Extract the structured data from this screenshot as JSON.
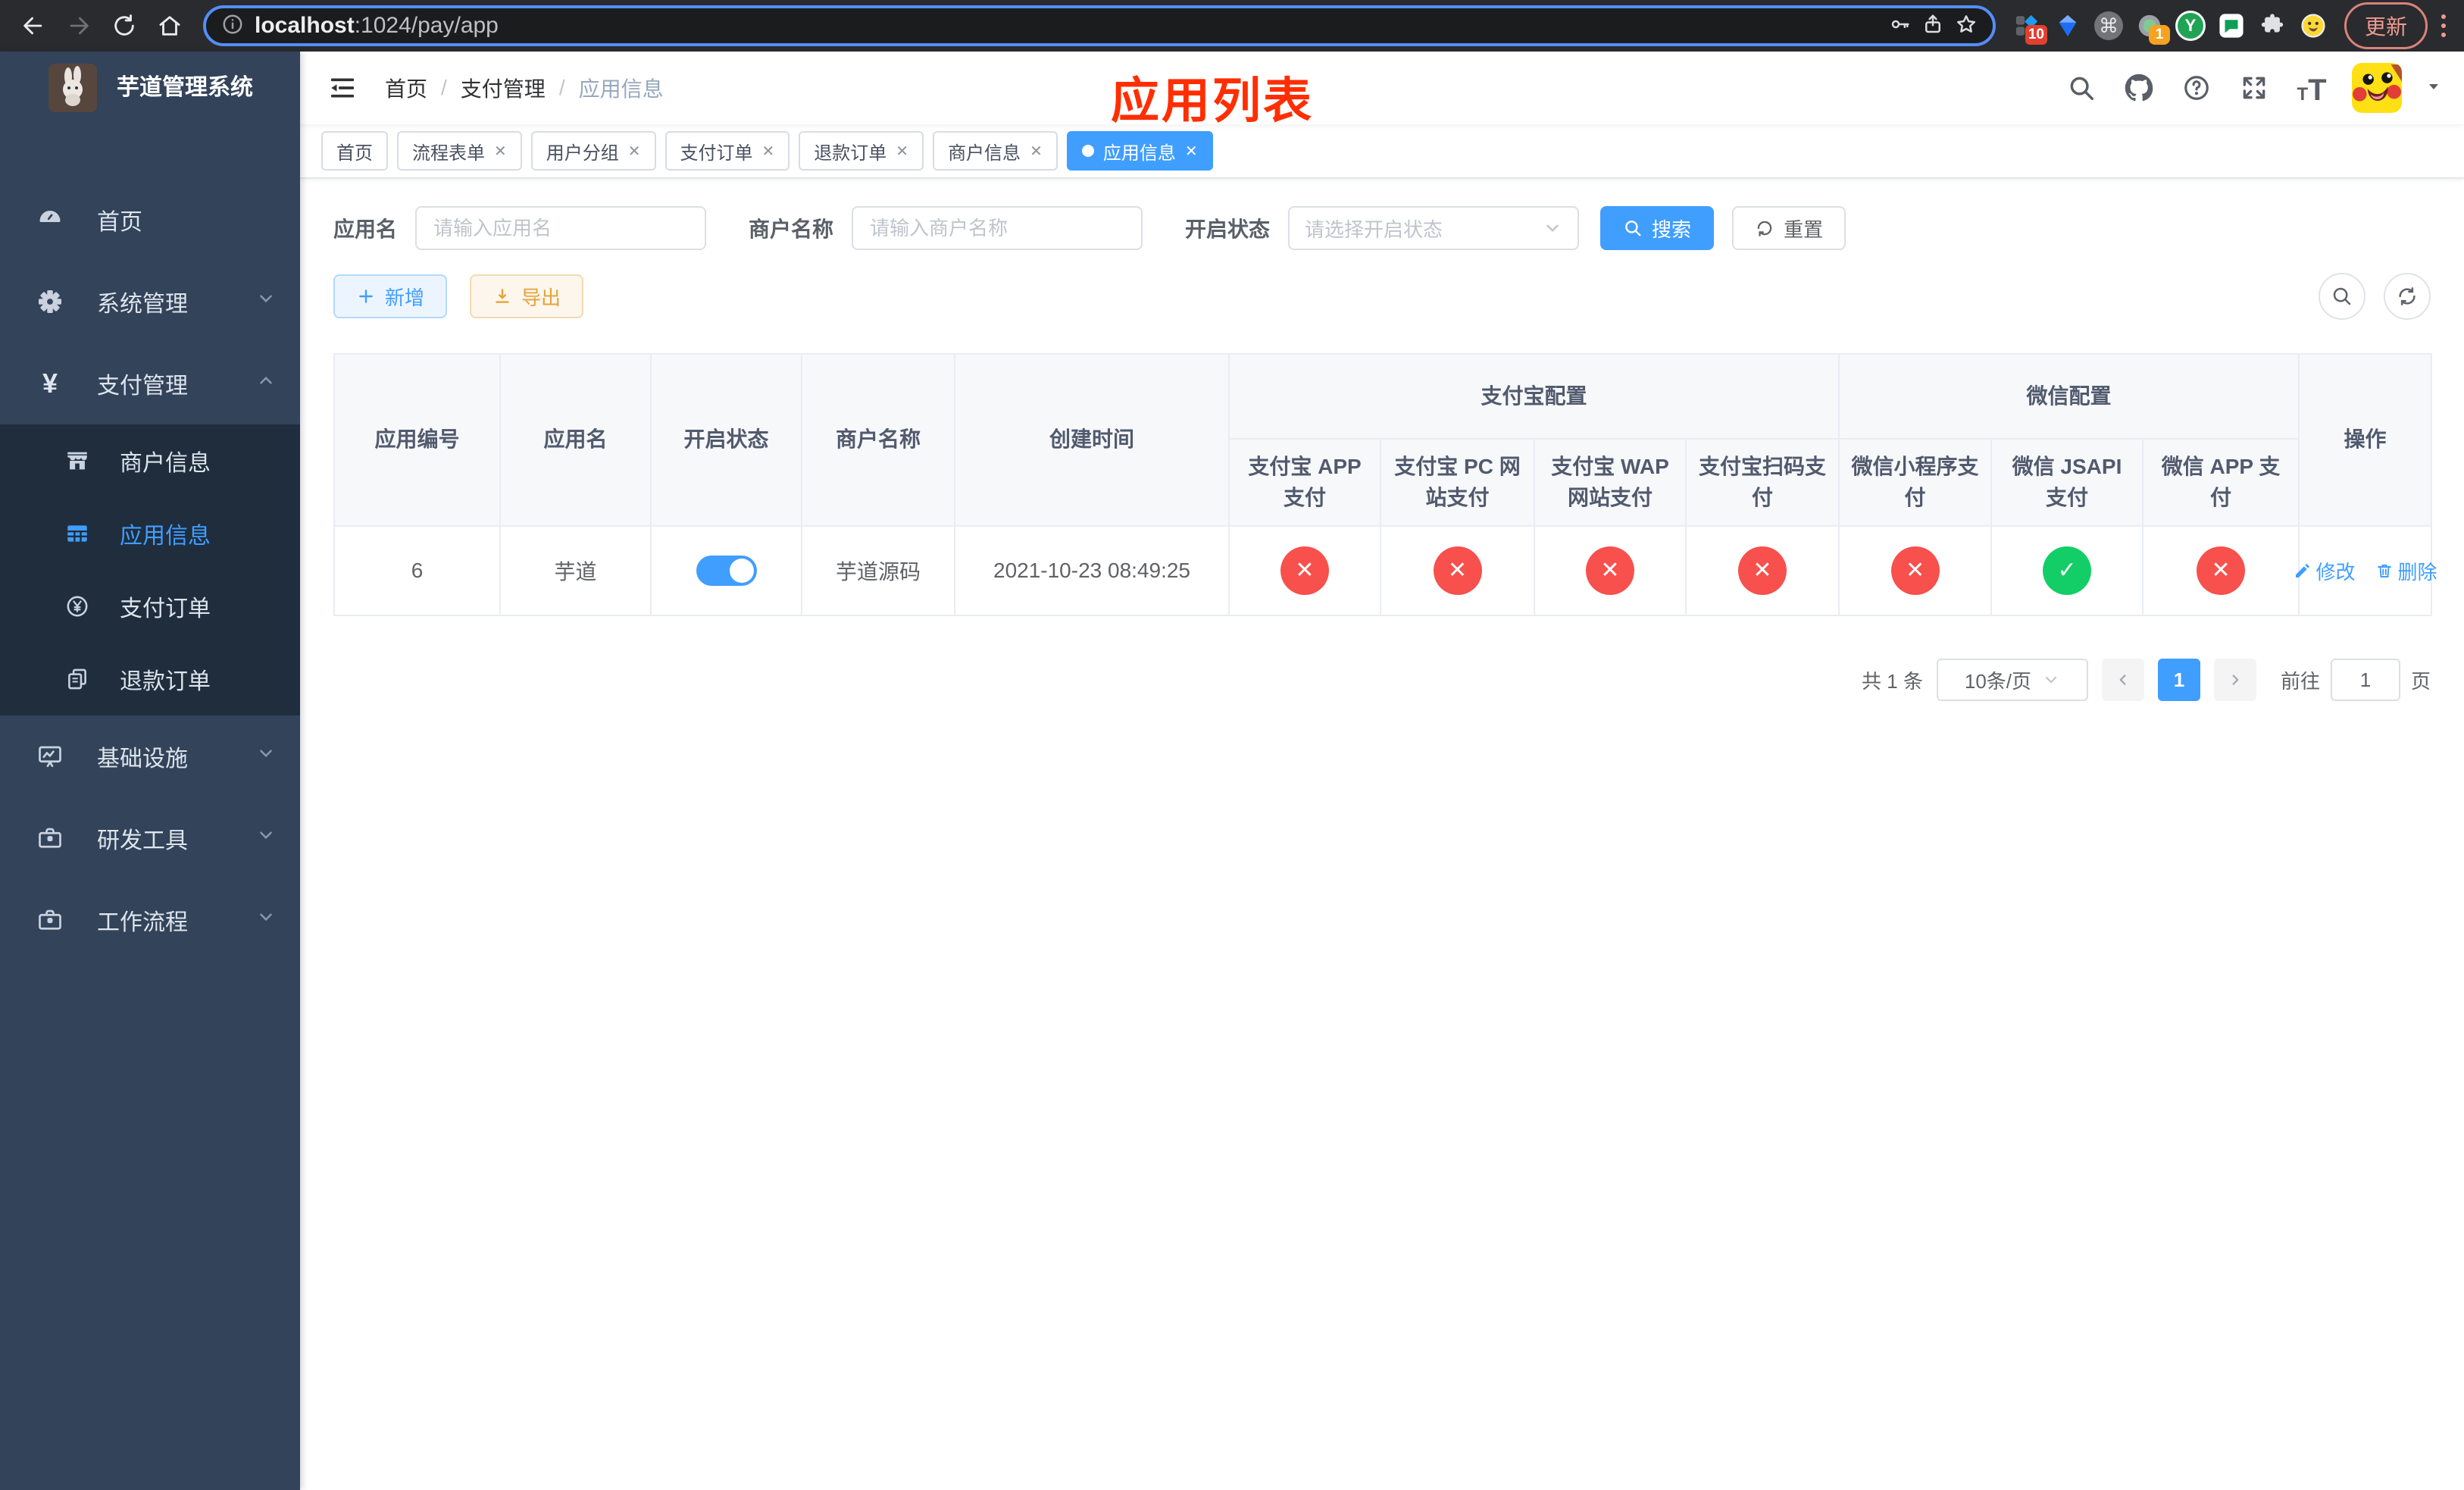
{
  "colors": {
    "accent": "#409eff",
    "danger": "#f7504d",
    "success": "#13ce66",
    "warning": "#e6a23c",
    "sidebar_bg": "#32435a",
    "sidebar_sub_bg": "#1f2d3d",
    "annotation_red": "#ff2e00"
  },
  "glyphs": {
    "close": "✕",
    "check": "✓",
    "cross": "✕",
    "yen": "¥",
    "help": "?",
    "cmd": "⌘",
    "y_ext": "Y",
    "font_small": "T",
    "font_big": "T",
    "breadcrumb_sep": "/"
  },
  "browser": {
    "url_host": "localhost",
    "url_path": ":1024/pay/app",
    "ext_badge_workflow": "10",
    "ext_badge_proxy": "1",
    "update_label": "更新"
  },
  "sidebar": {
    "title": "芋道管理系统",
    "items": [
      {
        "label": "首页"
      },
      {
        "label": "系统管理"
      },
      {
        "label": "支付管理"
      },
      {
        "label": "商户信息"
      },
      {
        "label": "应用信息"
      },
      {
        "label": "支付订单"
      },
      {
        "label": "退款订单"
      },
      {
        "label": "基础设施"
      },
      {
        "label": "研发工具"
      },
      {
        "label": "工作流程"
      }
    ]
  },
  "header": {
    "breadcrumb": [
      "首页",
      "支付管理",
      "应用信息"
    ],
    "overlay_title": "应用列表"
  },
  "tabs": [
    {
      "label": "首页"
    },
    {
      "label": "流程表单"
    },
    {
      "label": "用户分组"
    },
    {
      "label": "支付订单"
    },
    {
      "label": "退款订单"
    },
    {
      "label": "商户信息"
    },
    {
      "label": "应用信息"
    }
  ],
  "filters": {
    "app_name_label": "应用名",
    "app_name_placeholder": "请输入应用名",
    "merchant_label": "商户名称",
    "merchant_placeholder": "请输入商户名称",
    "status_label": "开启状态",
    "status_placeholder": "请选择开启状态",
    "search_label": "搜索",
    "reset_label": "重置"
  },
  "toolbar": {
    "add_label": "新增",
    "export_label": "导出"
  },
  "table": {
    "col_id": "应用编号",
    "col_name": "应用名",
    "col_status": "开启状态",
    "col_merchant": "商户名称",
    "col_created": "创建时间",
    "group_alipay": "支付宝配置",
    "group_wechat": "微信配置",
    "col_ops": "操作",
    "sub_alipay": [
      "支付宝 APP 支付",
      "支付宝 PC 网站支付",
      "支付宝 WAP 网站支付",
      "支付宝扫码支付"
    ],
    "sub_wechat": [
      "微信小程序支付",
      "微信 JSAPI 支付",
      "微信 APP 支付"
    ],
    "row": {
      "id": "6",
      "name": "芋道",
      "enabled": true,
      "merchant": "芋道源码",
      "created_at": "2021-10-23 08:49:25",
      "statuses": [
        false,
        false,
        false,
        false,
        false,
        true,
        false
      ],
      "op_edit": "修改",
      "op_delete": "删除"
    }
  },
  "pagination": {
    "total_label": "共 1 条",
    "page_size_label": "10条/页",
    "current_page": "1",
    "goto_label": "前往",
    "goto_value": "1",
    "page_unit_label": "页"
  }
}
